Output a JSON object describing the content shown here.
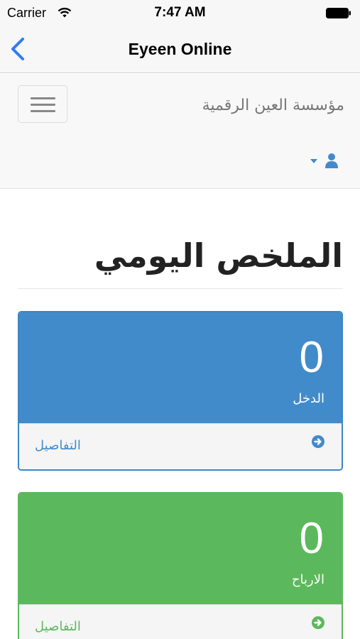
{
  "status_bar": {
    "carrier": "Carrier",
    "time": "7:47 AM"
  },
  "nav": {
    "title": "Eyeen Online",
    "back_icon": "chevron-left-icon"
  },
  "site_header": {
    "brand": "مؤسسة العين الرقمية",
    "menu_icon": "hamburger-icon",
    "user_icon": "user-icon"
  },
  "page": {
    "title": "الملخص اليومي"
  },
  "panels": [
    {
      "value": "0",
      "label": "الدخل",
      "details": "التفاصيل",
      "color": "#428bca"
    },
    {
      "value": "0",
      "label": "الارباح",
      "details": "التفاصيل",
      "color": "#5cb85c"
    }
  ],
  "colors": {
    "accent": "#2f7cf6",
    "primary": "#428bca",
    "success": "#5cb85c"
  }
}
